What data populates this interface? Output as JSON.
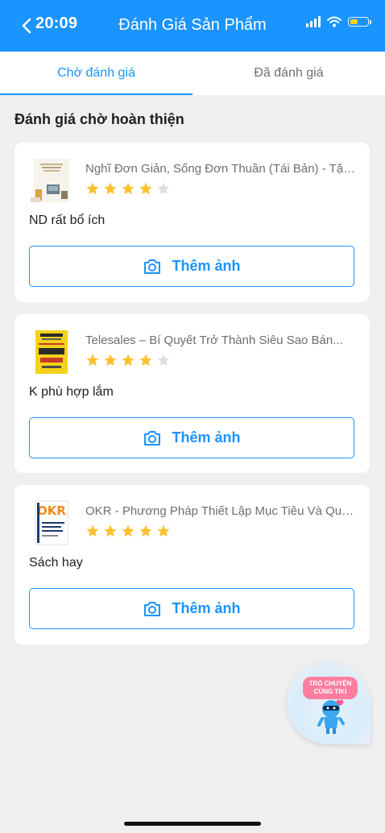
{
  "status_bar": {
    "time": "20:09"
  },
  "header": {
    "title": "Đánh Giá Sản Phẩm",
    "back_icon": "chevron-left-icon"
  },
  "tabs": [
    {
      "label": "Chờ đánh giá",
      "active": true
    },
    {
      "label": "Đã đánh giá",
      "active": false
    }
  ],
  "section_title": "Đánh giá chờ hoàn thiện",
  "reviews": [
    {
      "product_name": "Nghĩ Đơn Giản, Sống Đơn Thuần (Tái Bản) - Tặng ...",
      "rating": 4,
      "max_rating": 5,
      "review_text": "ND rất bổ ích",
      "button_label": "Thêm ảnh"
    },
    {
      "product_name": "Telesales – Bí Quyết Trở Thành Siêu Sao Bán...",
      "rating": 4,
      "max_rating": 5,
      "review_text": "K phù hợp lắm",
      "button_label": "Thêm ảnh"
    },
    {
      "product_name": "OKR - Phương Pháp Thiết Lập Mục Tiêu Và Quản...",
      "rating": 5,
      "max_rating": 5,
      "review_text": "Sách hay",
      "button_label": "Thêm ảnh"
    }
  ],
  "chat_widget": {
    "label": "TRÒ CHUYỆN CÙNG TIKI"
  },
  "colors": {
    "brand_blue": "#1a94ff",
    "star_filled": "#fdc02f",
    "star_empty": "#dddde3",
    "background": "#efefef"
  }
}
